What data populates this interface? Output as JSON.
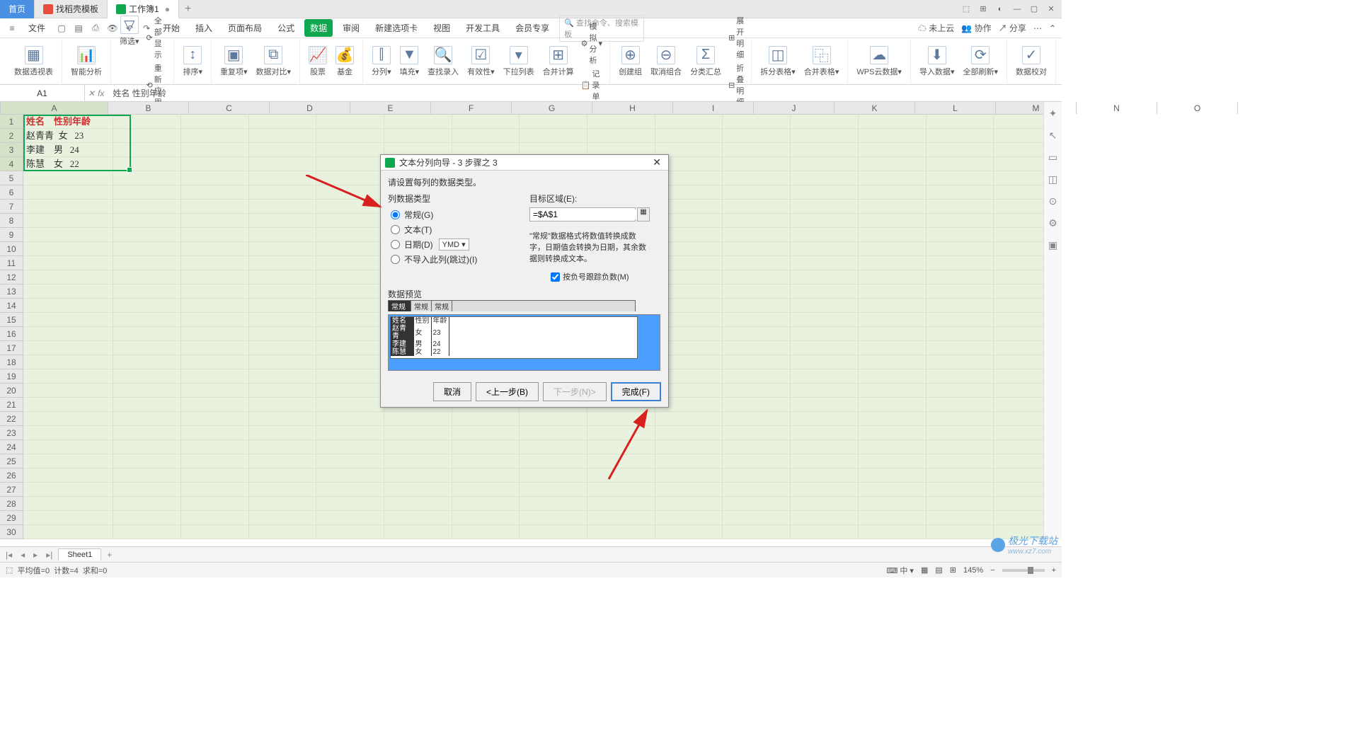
{
  "titlebar": {
    "home": "首页",
    "tab1": "找稻壳模板",
    "tab2": "工作簿1"
  },
  "menubar": {
    "file": "文件",
    "tabs": [
      "开始",
      "插入",
      "页面布局",
      "公式",
      "数据",
      "审阅",
      "新建选项卡",
      "视图",
      "开发工具",
      "会员专享"
    ],
    "search_placeholder": "查找命令、搜索模板",
    "right": {
      "cloud": "未上云",
      "coop": "协作",
      "share": "分享"
    }
  },
  "ribbon": {
    "pivot": "数据透视表",
    "smart": "智能分析",
    "filter": "筛选",
    "showall": "全部显示",
    "reapply": "重新应用",
    "sort": "排序",
    "dup": "重复项",
    "compare": "数据对比",
    "stock": "股票",
    "fund": "基金",
    "split": "分列",
    "fill": "填充",
    "lookup": "查找录入",
    "validate": "有效性",
    "dropdown": "下拉列表",
    "consol": "合并计算",
    "sim": "模拟分析",
    "record": "记录单",
    "group": "创建组",
    "ungroup": "取消组合",
    "subtotal": "分类汇总",
    "expand": "展开明细",
    "collapse": "折叠明细",
    "splittbl": "拆分表格",
    "mergetbl": "合并表格",
    "wpscloud": "WPS云数据",
    "import": "导入数据",
    "refresh": "全部刷新",
    "proof": "数据校对"
  },
  "namebox": "A1",
  "formula": "姓名    性别年龄",
  "columns": [
    "A",
    "B",
    "C",
    "D",
    "E",
    "F",
    "G",
    "H",
    "I",
    "J",
    "K",
    "L",
    "M",
    "N",
    "O"
  ],
  "rows_count": 30,
  "cells": {
    "A1": "姓名    性别年龄",
    "A2": "赵青青  女   23",
    "A3": "李建    男   24",
    "A4": "陈慧    女   22"
  },
  "sheet": "Sheet1",
  "status": {
    "avg": "平均值=0",
    "count": "计数=4",
    "sum": "求和=0",
    "zoom": "145%"
  },
  "dialog": {
    "title": "文本分列向导 - 3 步骤之 3",
    "instr": "请设置每列的数据类型。",
    "coltype_label": "列数据类型",
    "opt_general": "常规(G)",
    "opt_text": "文本(T)",
    "opt_date": "日期(D)",
    "date_fmt": "YMD",
    "opt_skip": "不导入此列(跳过)(I)",
    "target_label": "目标区域(E):",
    "target_value": "=$A$1",
    "desc": "\"常规\"数据格式将数值转换成数字，日期值会转换为日期，其余数据则转换成文本。",
    "chk_neg": "按负号跟踪负数(M)",
    "preview_label": "数据预览",
    "preview_headers": [
      "常规",
      "常规",
      "常规"
    ],
    "preview_rows": [
      [
        "姓名",
        "性别",
        "年龄"
      ],
      [
        "赵青青",
        "女",
        "23"
      ],
      [
        "李建",
        "男",
        "24"
      ],
      [
        "陈慧",
        "女",
        "22"
      ]
    ],
    "btn_cancel": "取消",
    "btn_prev": "<上一步(B)",
    "btn_next": "下一步(N)>",
    "btn_finish": "完成(F)"
  },
  "watermark": {
    "name": "极光下载站",
    "url": "www.xz7.com"
  }
}
